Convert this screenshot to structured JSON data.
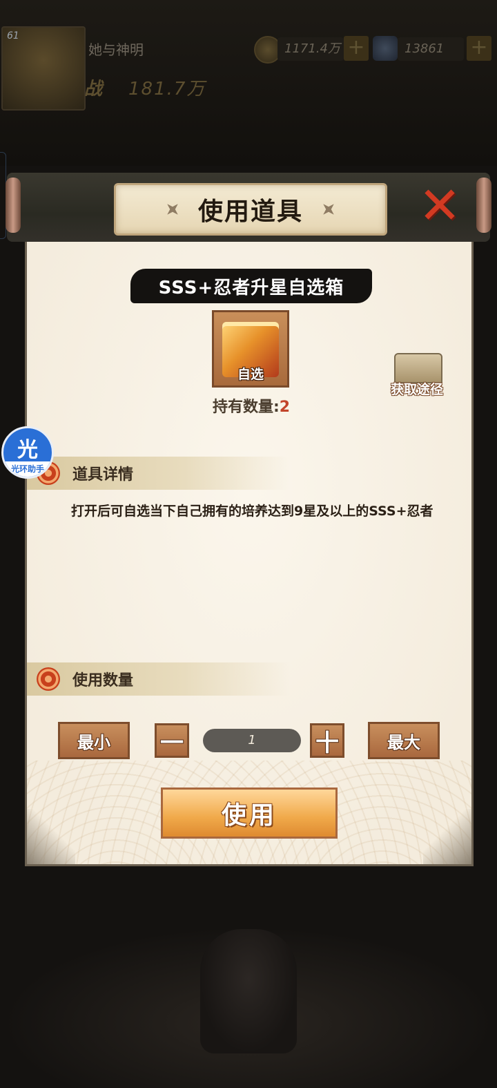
{
  "hud": {
    "level": "61",
    "player_name": "她与神明",
    "power_label": "战",
    "power_value": "181.7万",
    "coins": "1171.4万",
    "gems": "13861",
    "plus_symbol": "+"
  },
  "dialog": {
    "title": "使用道具",
    "close_symbol": "✕",
    "item_name": "SSS+忍者升星自选箱",
    "item_tag": "自选",
    "owned_label": "持有数量:",
    "owned_count": "2",
    "source_label": "获取途径",
    "details_header": "道具详情",
    "description": "打开后可自选当下自己拥有的培养达到9星及以上的SSS+忍者",
    "quantity_header": "使用数量",
    "min_label": "最小",
    "max_label": "最大",
    "dec_symbol": "一",
    "inc_symbol": "十",
    "quantity_value": "1",
    "use_label": "使用"
  },
  "helper": {
    "glyph": "光",
    "label": "光环助手"
  },
  "colors": {
    "accent_red": "#c2442a",
    "button_brown": "#a9683e",
    "use_button_orange": "#f0a94a",
    "paper": "#f4ecdd",
    "helper_blue": "#2a6fd6"
  },
  "icons": [
    "avatar",
    "coin-icon",
    "gem-icon",
    "shuriken-icon",
    "close-icon",
    "chest-icon",
    "swirl-icon",
    "helper-icon"
  ]
}
